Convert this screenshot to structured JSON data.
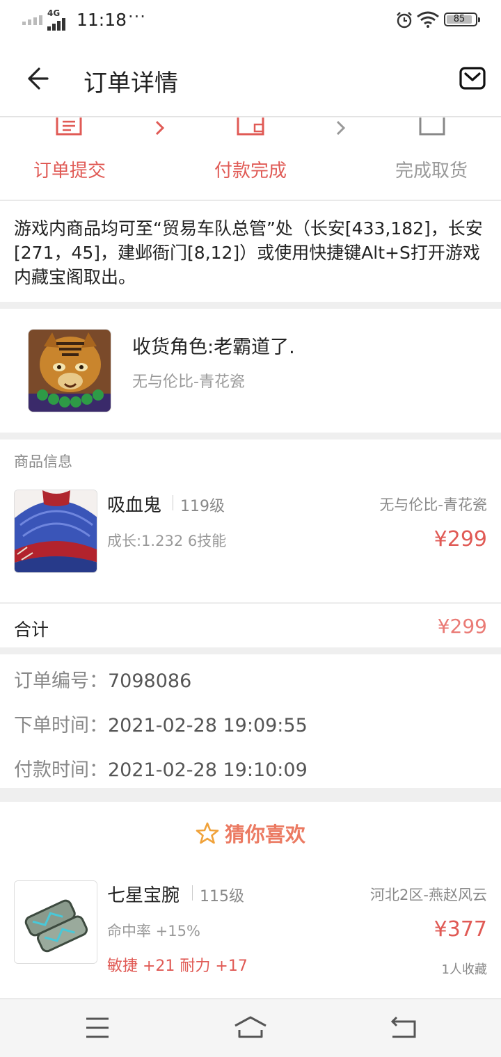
{
  "status_bar": {
    "time": "11:18",
    "more": "···",
    "network": "4G",
    "battery": "85"
  },
  "header": {
    "title": "订单详情"
  },
  "steps": [
    {
      "label": "订单提交",
      "active": true
    },
    {
      "label": "付款完成",
      "active": true
    },
    {
      "label": "完成取货",
      "active": false
    }
  ],
  "notice": "游戏内商品均可至“贸易车队总管”处（长安[433,182]，长安[271，45]，建邺衙门[8,12]）或使用快捷键Alt+S打开游戏内藏宝阁取出。",
  "receiver": {
    "role": "收货角色:老霸道了.",
    "server": "无与伦比-青花瓷"
  },
  "goods": {
    "section_title": "商品信息",
    "item": {
      "name": "吸血鬼",
      "level": "119级",
      "server": "无与伦比-青花瓷",
      "attributes": "成长:1.232 6技能",
      "price": "¥299"
    }
  },
  "total": {
    "label": "合计",
    "price": "¥299"
  },
  "order": {
    "number_label": "订单编号：",
    "number": "7098086",
    "created_label": "下单时间：",
    "created": "2021-02-28 19:09:55",
    "paid_label": "付款时间：",
    "paid": "2021-02-28 19:10:09"
  },
  "recommend": {
    "title": "猜你喜欢",
    "items": [
      {
        "name": "七星宝腕",
        "level": "115级",
        "server": "河北2区-燕赵风云",
        "attr1": "命中率 +15%",
        "attr2": "敏捷 +21 耐力 +17",
        "price": "¥377",
        "favorites": "1人收藏"
      }
    ]
  },
  "colors": {
    "accent": "#e05a55",
    "inactive": "#999999"
  }
}
